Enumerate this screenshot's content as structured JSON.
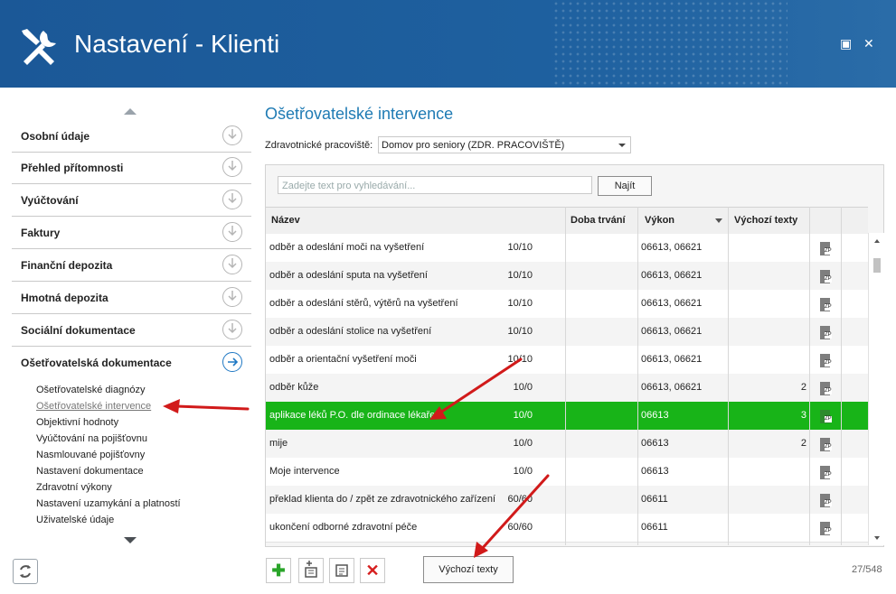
{
  "window": {
    "title": "Nastavení - Klienti",
    "maximize": "▣",
    "close": "✕"
  },
  "sidebar": {
    "sections": [
      {
        "label": "Osobní údaje"
      },
      {
        "label": "Přehled přítomnosti"
      },
      {
        "label": "Vyúčtování"
      },
      {
        "label": "Faktury"
      },
      {
        "label": "Finanční depozita"
      },
      {
        "label": "Hmotná depozita"
      },
      {
        "label": "Sociální dokumentace"
      },
      {
        "label": "Ošetřovatelská dokumentace"
      }
    ],
    "subitems": [
      {
        "label": "Ošetřovatelské diagnózy"
      },
      {
        "label": "Ošetřovatelské intervence"
      },
      {
        "label": "Objektivní hodnoty"
      },
      {
        "label": "Vyúčtování na pojišťovnu"
      },
      {
        "label": "Nasmlouvané pojišťovny"
      },
      {
        "label": "Nastavení dokumentace"
      },
      {
        "label": "Zdravotní výkony"
      },
      {
        "label": "Nastavení uzamykání a platností"
      },
      {
        "label": "Uživatelské údaje"
      }
    ]
  },
  "main": {
    "title": "Ošetřovatelské intervence",
    "workplace_label": "Zdravotnické pracoviště:",
    "workplace_value": "Domov pro seniory (ZDR. PRACOVIŠTĚ)",
    "search_placeholder": "Zadejte text pro vyhledávání...",
    "find_button": "Najít",
    "columns": [
      "Název",
      "Doba trvání",
      "Výkon",
      "Výchozí texty"
    ],
    "rows": [
      {
        "name": "odběr a odeslání moči na vyšetření",
        "duration": "10/10",
        "code": "06613, 06621",
        "defaults": ""
      },
      {
        "name": "odběr a odeslání sputa na vyšetření",
        "duration": "10/10",
        "code": "06613, 06621",
        "defaults": ""
      },
      {
        "name": "odběr a odeslání stěrů, výtěrů na vyšetření",
        "duration": "10/10",
        "code": "06613, 06621",
        "defaults": ""
      },
      {
        "name": "odběr a odeslání stolice na vyšetření",
        "duration": "10/10",
        "code": "06613, 06621",
        "defaults": ""
      },
      {
        "name": "odběr a orientační vyšetření moči",
        "duration": "10/10",
        "code": "06613, 06621",
        "defaults": ""
      },
      {
        "name": "odběr kůže",
        "duration": "10/0",
        "code": "06613, 06621",
        "defaults": "2"
      },
      {
        "name": "aplikace léků P.O. dle ordinace lékaře",
        "duration": "10/0",
        "code": "06613",
        "defaults": "3"
      },
      {
        "name": "mije",
        "duration": "10/0",
        "code": "06613",
        "defaults": "2"
      },
      {
        "name": "Moje intervence",
        "duration": "10/0",
        "code": "06613",
        "defaults": ""
      },
      {
        "name": "překlad klienta do / zpět ze zdravotnického zařízení",
        "duration": "60/60",
        "code": "06611",
        "defaults": ""
      },
      {
        "name": "ukončení odborné zdravotní péče",
        "duration": "60/60",
        "code": "06611",
        "defaults": ""
      }
    ],
    "default_texts_button": "Výchozí texty",
    "counter": "27/548"
  },
  "colors": {
    "titlebar": "#1d5c9c",
    "selected_row": "#18b418",
    "accent": "#1f7bb4",
    "annotation_arrow": "#d11a1a"
  }
}
